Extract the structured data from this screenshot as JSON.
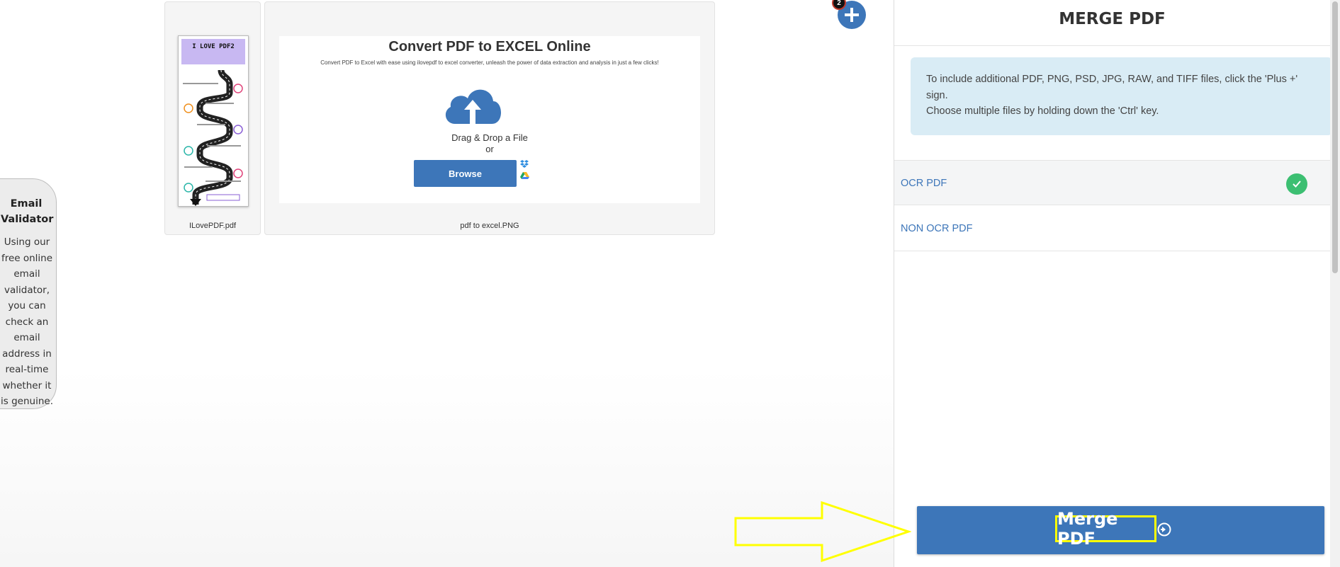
{
  "email_validator": {
    "title": "Email Validator",
    "description": "Using our free online email validator, you can check an email address in real-time whether it is genuine."
  },
  "files": [
    {
      "name": "ILovePDF.pdf",
      "thumb_title": "I LOVE PDF2"
    },
    {
      "name": "pdf to excel.PNG",
      "thumb_heading": "Convert PDF to EXCEL Online",
      "thumb_text": "Convert PDF to Excel with ease using ilovepdf to excel converter, unleash the power of data extraction and analysis in just a few clicks!",
      "drag_text": "Drag & Drop a File",
      "or_text": "or",
      "browse_label": "Browse"
    }
  ],
  "add_files": {
    "badge_count": "2",
    "icon": "plus-icon"
  },
  "panel": {
    "title": "MERGE PDF",
    "info_line1": "To include additional PDF, PNG, PSD, JPG, RAW, and TIFF files, click the 'Plus +' sign.",
    "info_line2": "Choose multiple files by holding down the 'Ctrl' key.",
    "options": [
      {
        "label": "OCR PDF",
        "selected": true
      },
      {
        "label": "NON OCR PDF",
        "selected": false
      }
    ],
    "merge_label": "Merge PDF"
  },
  "colors": {
    "accent": "#3d76b9",
    "highlight": "#ffff00",
    "success": "#3cbf72",
    "info_bg": "#d9ecf5"
  }
}
